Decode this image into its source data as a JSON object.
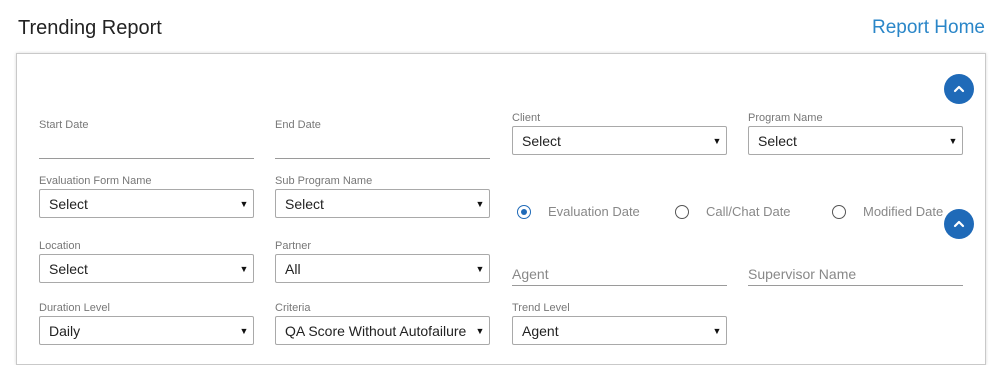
{
  "header": {
    "title": "Trending Report",
    "home_link": "Report Home"
  },
  "icons": {
    "collapse": "chevron-up-icon",
    "dropdown": "dropdown-arrow-icon"
  },
  "colors": {
    "accent": "#1f6ab8",
    "link": "#2a86c8"
  },
  "filters": {
    "start_date": {
      "label": "Start Date",
      "value": ""
    },
    "end_date": {
      "label": "End Date",
      "value": ""
    },
    "client": {
      "label": "Client",
      "value": "Select"
    },
    "program_name": {
      "label": "Program Name",
      "value": "Select"
    },
    "evaluation_form_name": {
      "label": "Evaluation Form Name",
      "value": "Select"
    },
    "sub_program_name": {
      "label": "Sub Program Name",
      "value": "Select"
    },
    "date_type": {
      "selected": "Evaluation Date",
      "options": [
        "Evaluation Date",
        "Call/Chat Date",
        "Modified Date"
      ]
    },
    "location": {
      "label": "Location",
      "value": "Select"
    },
    "partner": {
      "label": "Partner",
      "value": "All"
    },
    "agent": {
      "placeholder": "Agent"
    },
    "supervisor": {
      "placeholder": "Supervisor Name"
    },
    "duration_level": {
      "label": "Duration Level",
      "value": "Daily"
    },
    "criteria": {
      "label": "Criteria",
      "value": "QA Score Without Autofailure"
    },
    "trend_level": {
      "label": "Trend Level",
      "value": "Agent"
    }
  }
}
